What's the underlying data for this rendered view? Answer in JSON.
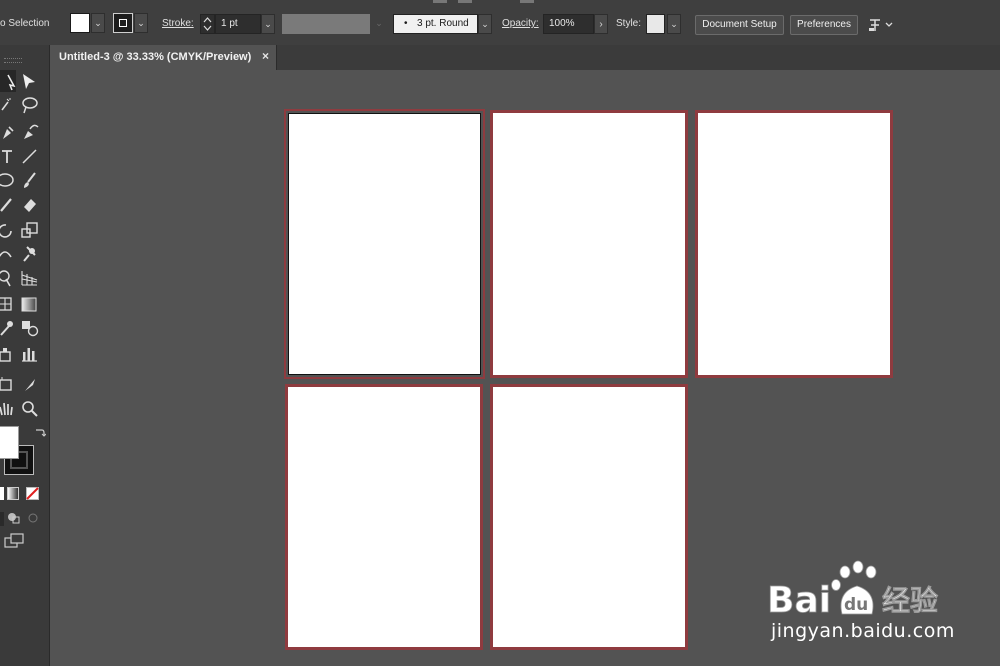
{
  "control_bar": {
    "selection_label": "o Selection",
    "stroke_label": "Stroke:",
    "stroke_weight": "1 pt",
    "brush_preset": "3 pt. Round",
    "opacity_label": "Opacity:",
    "opacity_value": "100%",
    "style_label": "Style:",
    "document_setup_label": "Document Setup",
    "preferences_label": "Preferences",
    "fill_color": "#ffffff",
    "stroke_color": "#000000"
  },
  "document_tab": {
    "title": "Untitled-3 @ 33.33% (CMYK/Preview)",
    "close_glyph": "×"
  },
  "toolbar": {
    "tools": [
      "selection-tool",
      "direct-selection-tool",
      "magic-wand-tool",
      "lasso-tool",
      "pen-tool",
      "curvature-tool",
      "type-tool",
      "line-tool",
      "ellipse-tool",
      "paintbrush-tool",
      "pencil-tool",
      "eraser-tool",
      "rotate-tool",
      "scale-tool",
      "width-tool",
      "puppet-warp-tool",
      "shape-builder-tool",
      "perspective-grid-tool",
      "mesh-tool",
      "gradient-tool",
      "eyedropper-tool",
      "blend-tool",
      "symbol-sprayer-tool",
      "column-graph-tool",
      "artboard-tool",
      "slice-tool",
      "hand-tool",
      "zoom-tool"
    ],
    "fill_color": "#ffffff",
    "stroke_color": "#000000"
  },
  "artboards": {
    "count": 5,
    "border_color": "#8f3b3f",
    "active_index": 0
  },
  "watermark": {
    "brand": "Bai du 经验",
    "url": "jingyan.baidu.com"
  }
}
